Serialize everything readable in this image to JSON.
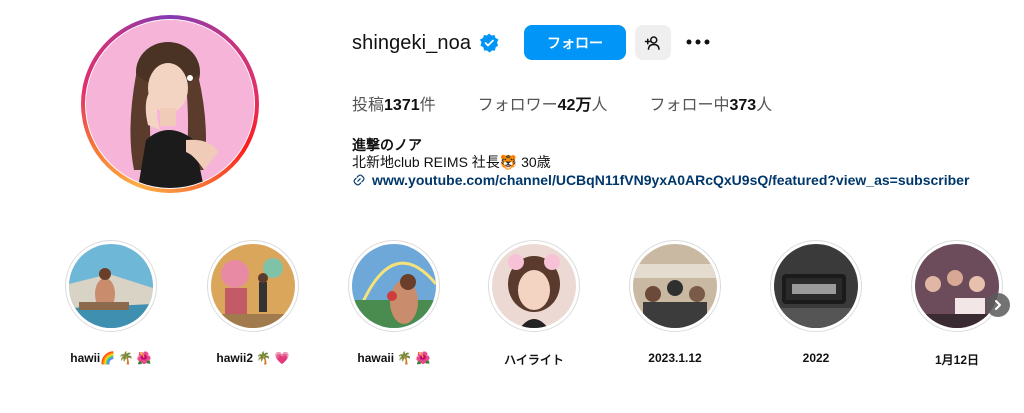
{
  "profile": {
    "username": "shingeki_noa",
    "follow_label": "フォロー",
    "stats": {
      "posts_prefix": "投稿",
      "posts_count": "1371",
      "posts_suffix": "件",
      "followers_prefix": "フォロワー",
      "followers_count": "42万",
      "followers_suffix": "人",
      "following_prefix": "フォロー中",
      "following_count": "373",
      "following_suffix": "人"
    },
    "full_name": "進撃のノア",
    "bio": "北新地club REIMS 社長🐯 30歳",
    "link": "www.youtube.com/channel/UCBqN11fVN9yxA0ARcQxU9sQ/featured?view_as=subscriber"
  },
  "highlights": [
    {
      "label": "hawii🌈 🌴 🌺"
    },
    {
      "label": "hawii2 🌴 💗"
    },
    {
      "label": "hawaii 🌴 🌺"
    },
    {
      "label": "ハイライト"
    },
    {
      "label": "2023.1.12"
    },
    {
      "label": "2022"
    },
    {
      "label": "1月12日"
    }
  ],
  "icons": {
    "verified": "verified-badge-icon",
    "suggest": "add-person-icon",
    "more": "more-options-icon",
    "link": "link-icon",
    "next": "chevron-right-icon"
  },
  "colors": {
    "accent": "#0095f6",
    "link": "#00376b",
    "verified": "#0095f6"
  }
}
